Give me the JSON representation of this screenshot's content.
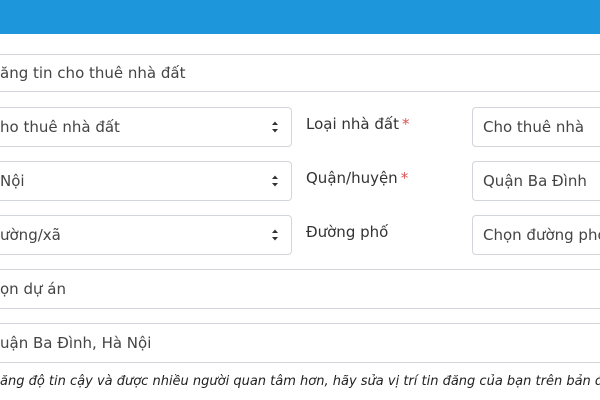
{
  "form": {
    "title_field": {
      "value": "ăng tin cho thuê nhà đất"
    },
    "listing_type": {
      "value": "ho thuê nhà đất"
    },
    "property_type": {
      "label": "Loại nhà đất",
      "required": "*",
      "value": "Cho thuê nhà"
    },
    "city": {
      "value": "Nội"
    },
    "district": {
      "label": "Quận/huyện",
      "required": "*",
      "value": "Quận Ba Đình"
    },
    "ward": {
      "value": "ường/xã"
    },
    "street": {
      "label": "Đường phố",
      "value": "Chọn đường phố"
    },
    "project": {
      "value": "ọn dự án"
    },
    "address": {
      "value": "uận Ba Đình, Hà Nội"
    },
    "hint": "ăng độ tin cậy và được nhiều người quan tâm hơn, hãy sửa vị trí tin đăng của bạn trên bản đồ bằng cách kéo"
  }
}
